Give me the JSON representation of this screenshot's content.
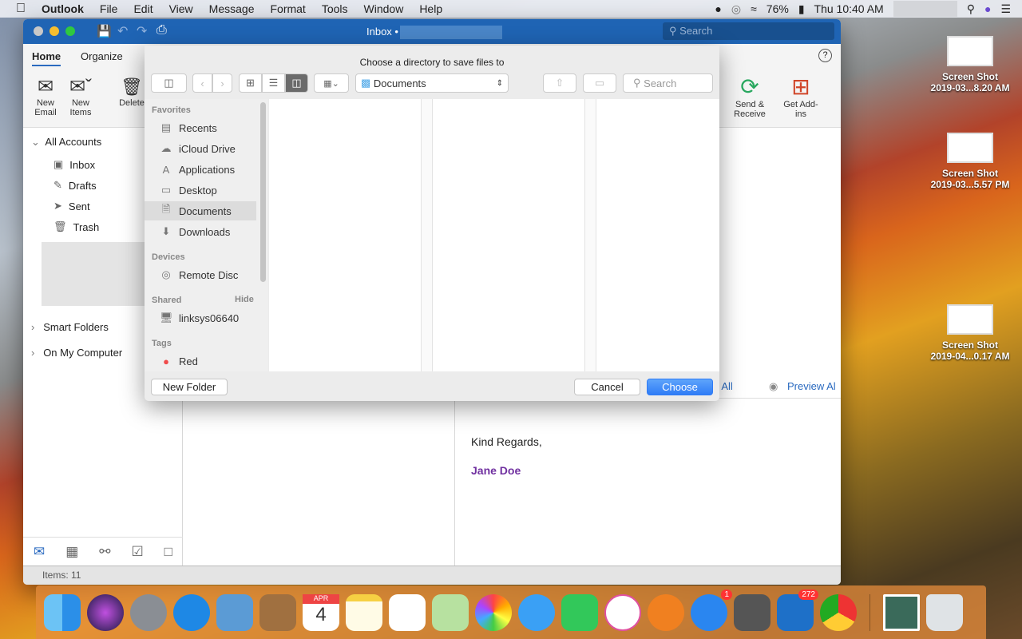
{
  "menubar": {
    "app": "Outlook",
    "items": [
      "File",
      "Edit",
      "View",
      "Message",
      "Format",
      "Tools",
      "Window",
      "Help"
    ],
    "battery": "76%",
    "clock": "Thu 10:40 AM"
  },
  "window": {
    "title": "Inbox •",
    "search_placeholder": "Search",
    "tabs": [
      "Home",
      "Organize"
    ],
    "ribbon": {
      "new_email": "New Email",
      "new_items": "New Items",
      "delete": "Delete",
      "send_receive": "Send & Receive",
      "get_addins": "Get Add-ins"
    },
    "folders": {
      "all_accounts": "All Accounts",
      "items": [
        "Inbox",
        "Drafts",
        "Sent",
        "Trash"
      ],
      "smart_folders": "Smart Folders",
      "on_my_computer": "On My Computer"
    },
    "reading": {
      "download_all": "ad All",
      "preview_all": "Preview Al",
      "closing": "Kind Regards,",
      "signature": "Jane Doe"
    },
    "status": "Items: 11"
  },
  "dialog": {
    "title": "Choose a directory to save files to",
    "location": "Documents",
    "search_placeholder": "Search",
    "favorites_header": "Favorites",
    "favorites": [
      "Recents",
      "iCloud Drive",
      "Applications",
      "Desktop",
      "Documents",
      "Downloads"
    ],
    "devices_header": "Devices",
    "devices": [
      "Remote Disc"
    ],
    "shared_header": "Shared",
    "shared_hide": "Hide",
    "shared": [
      "linksys06640"
    ],
    "tags_header": "Tags",
    "tags": [
      "Red"
    ],
    "new_folder": "New Folder",
    "cancel": "Cancel",
    "choose": "Choose",
    "selected": "Documents"
  },
  "desktop": [
    {
      "name": "Screen Shot",
      "date": "2019-03...8.20 AM"
    },
    {
      "name": "Screen Shot",
      "date": "2019-03...5.57 PM"
    },
    {
      "name": "Screen Shot",
      "date": "2019-04...0.17 AM"
    }
  ],
  "dock": {
    "calendar_month": "APR",
    "calendar_day": "4",
    "appstore_badge": "1",
    "outlook_badge": "272"
  },
  "colors": {
    "accent": "#2f7cf6",
    "titlebar": "#1f64b4",
    "signature": "#7030a0",
    "tag_red": "#f04b4b"
  }
}
